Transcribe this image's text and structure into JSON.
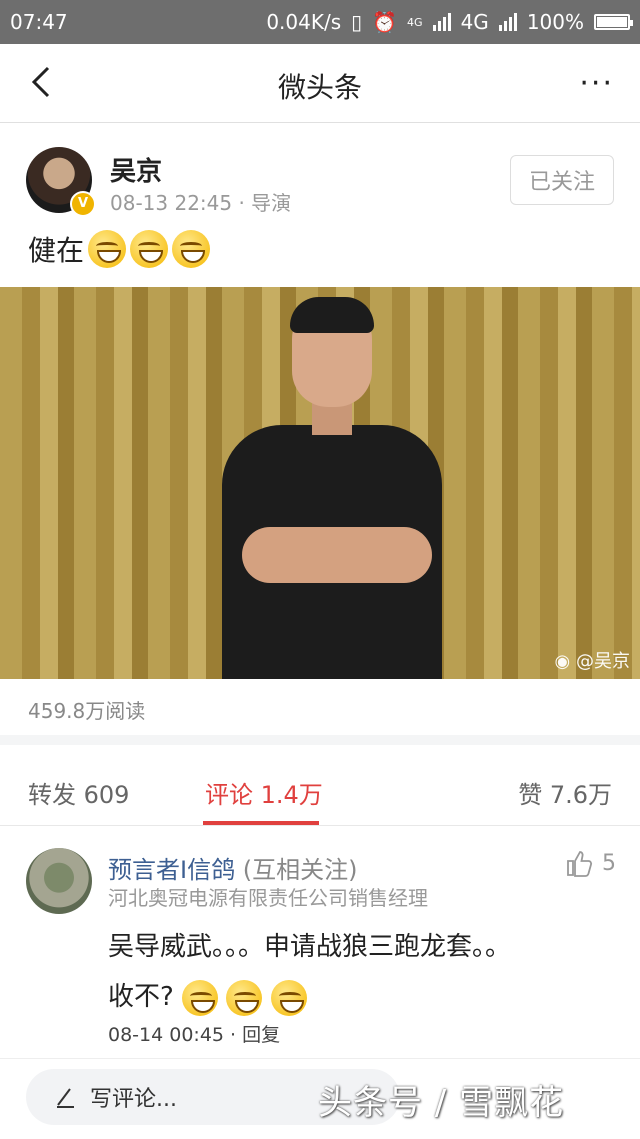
{
  "status_bar": {
    "time": "07:47",
    "speed": "0.04K/s",
    "network_small": "4G",
    "network": "4G",
    "battery": "100%",
    "battery_level": 1.0
  },
  "nav": {
    "title": "微头条",
    "more_label": "···"
  },
  "post": {
    "author_name": "吴京",
    "meta": "08-13 22:45 · 导演",
    "follow_label": "已关注",
    "verified_badge": "V",
    "text": "健在",
    "emoji_count": 3,
    "image_watermark": "@吴京",
    "reads": "459.8万阅读"
  },
  "tabs": {
    "repost": "转发 609",
    "comment": "评论 1.4万",
    "like": "赞 7.6万"
  },
  "comment": {
    "author": "预言者I信鸽",
    "relation": "(互相关注)",
    "title": "河北奥冠电源有限责任公司销售经理",
    "likes": "5",
    "text_line1": "吴导威武。。。申请战狼三跑龙套。。",
    "text_line2": "收不?",
    "time_reply": "08-14 00:45 · 回复"
  },
  "bottom": {
    "composer_placeholder": "写评论...",
    "brand_watermark": "头条号 / 雪飘花"
  }
}
